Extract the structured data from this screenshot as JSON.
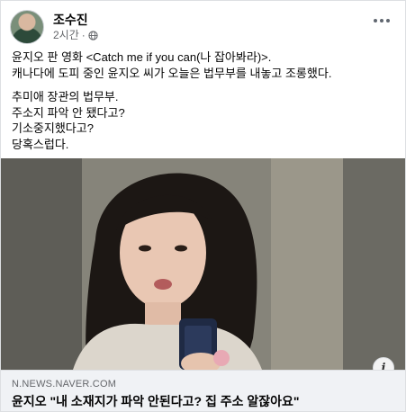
{
  "post": {
    "author": "조수진",
    "time": "2시간",
    "privacy_icon": "globe-icon",
    "lines_block1": [
      "윤지오 판 영화 <Catch me if you can(나 잡아봐라)>.",
      "캐나다에 도피 중인 윤지오 씨가 오늘은 법무부를 내놓고 조롱했다."
    ],
    "lines_block2": [
      "추미애 장관의 법무부.",
      "주소지 파악 안 됐다고?",
      "기소중지했다고?",
      "당혹스럽다."
    ]
  },
  "link": {
    "domain": "N.NEWS.NAVER.COM",
    "title": "윤지오 \"내 소재지가 파악 안된다고? 집 주소 알잖아요\""
  },
  "colors": {
    "text": "#050505",
    "secondary": "#65676b",
    "link_bg": "#f0f2f5"
  }
}
